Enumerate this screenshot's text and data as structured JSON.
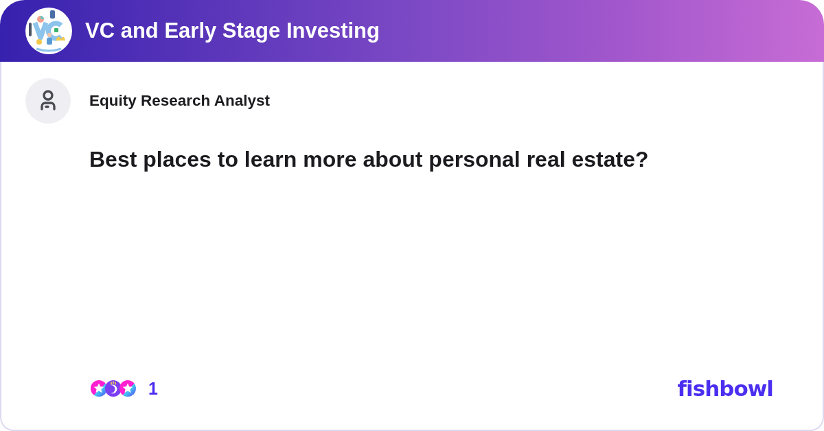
{
  "header": {
    "title": "VC and Early Stage Investing"
  },
  "post": {
    "author": "Equity Research Analyst",
    "question": "Best places to learn more about personal real estate?"
  },
  "footer": {
    "reaction_count": "1",
    "brand": "fishbowl"
  }
}
